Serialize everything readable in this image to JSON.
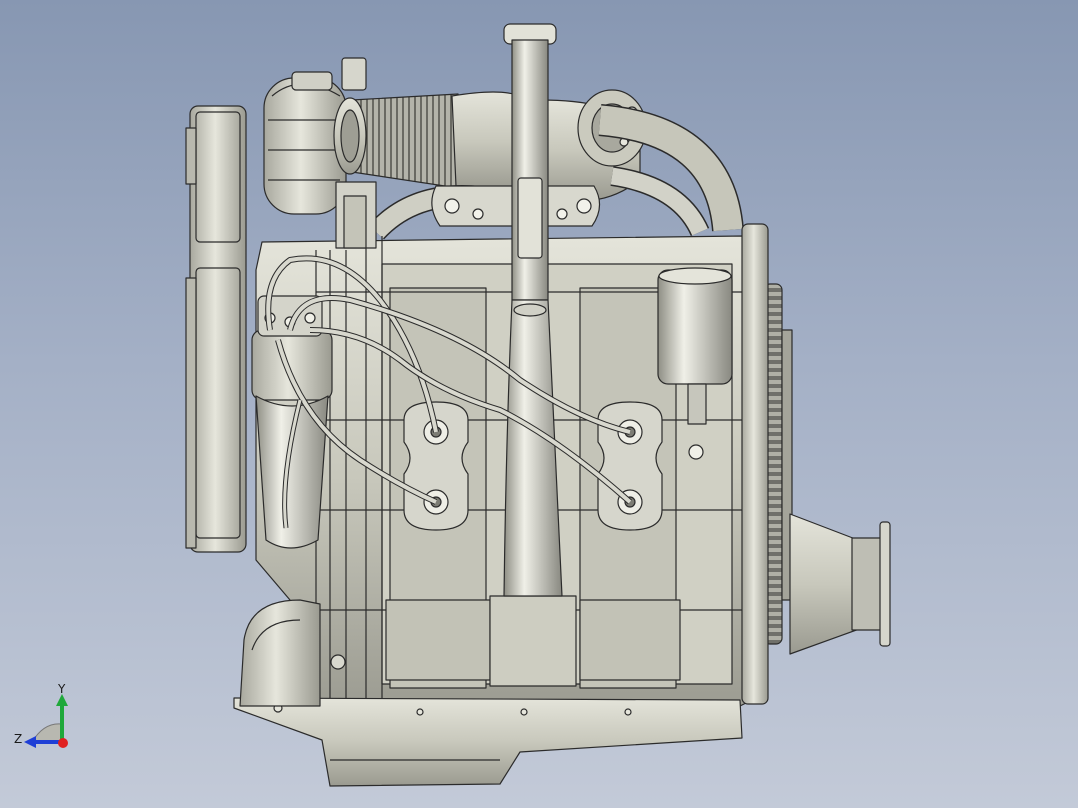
{
  "viewport": {
    "background_top": "#8797b2",
    "background_bottom": "#c3cad8"
  },
  "model": {
    "body_color": "#c8c8bc",
    "shade_color": "#8e8e84",
    "edge_color": "#2b2b2b"
  },
  "triad": {
    "y_label": "Y",
    "z_label": "Z",
    "y_color": "#1fa83a",
    "z_color": "#1f3fd6",
    "origin_color": "#e02020"
  }
}
